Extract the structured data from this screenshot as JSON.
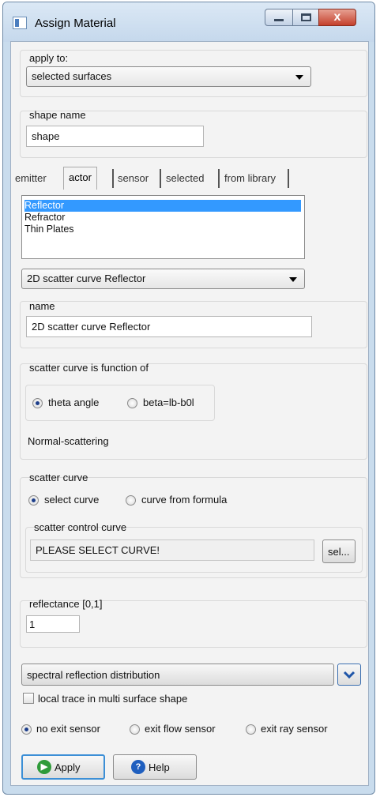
{
  "window": {
    "title": "Assign Material",
    "close_glyph": "x"
  },
  "apply_to": {
    "label": "apply to:",
    "value": "selected surfaces"
  },
  "shape_name": {
    "label": "shape name",
    "value": "shape"
  },
  "tabs": [
    {
      "label": "emitter",
      "active": false
    },
    {
      "label": "actor",
      "active": true
    },
    {
      "label": "sensor",
      "active": false
    },
    {
      "label": "selected",
      "active": false
    },
    {
      "label": "from library",
      "active": false
    }
  ],
  "actor_list": {
    "items": [
      "Reflector",
      "Refractor",
      "Thin Plates"
    ],
    "selected_index": 0
  },
  "actor_type": {
    "value": "2D scatter curve Reflector"
  },
  "name_field": {
    "label": "name",
    "value": "2D scatter curve Reflector"
  },
  "scatter_function": {
    "label": "scatter curve is function of",
    "options": [
      "theta angle",
      "beta=lb-b0l"
    ],
    "selected_index": 0,
    "note": "Normal-scattering"
  },
  "scatter_curve": {
    "label": "scatter curve",
    "options": [
      "select curve",
      "curve from formula"
    ],
    "selected_index": 0,
    "control_label": "scatter control curve",
    "control_value": "PLEASE SELECT CURVE!",
    "select_button": "sel..."
  },
  "reflectance": {
    "label": "reflectance [0,1]",
    "value": "1"
  },
  "spectral": {
    "value": "spectral reflection distribution"
  },
  "local_trace": {
    "label": "local trace in multi surface shape",
    "checked": false
  },
  "exit_sensor": {
    "options": [
      "no exit sensor",
      "exit flow sensor",
      "exit ray sensor"
    ],
    "selected_index": 0
  },
  "buttons": {
    "apply": "Apply",
    "help": "Help"
  },
  "colors": {
    "selection": "#3399ff",
    "title_bar": "#c9dced",
    "close_button": "#c4402c"
  },
  "icons": {
    "title": "window-app-icon",
    "apply": "green-play-icon",
    "help": "blue-question-icon",
    "expand": "chevron-down-icon"
  }
}
